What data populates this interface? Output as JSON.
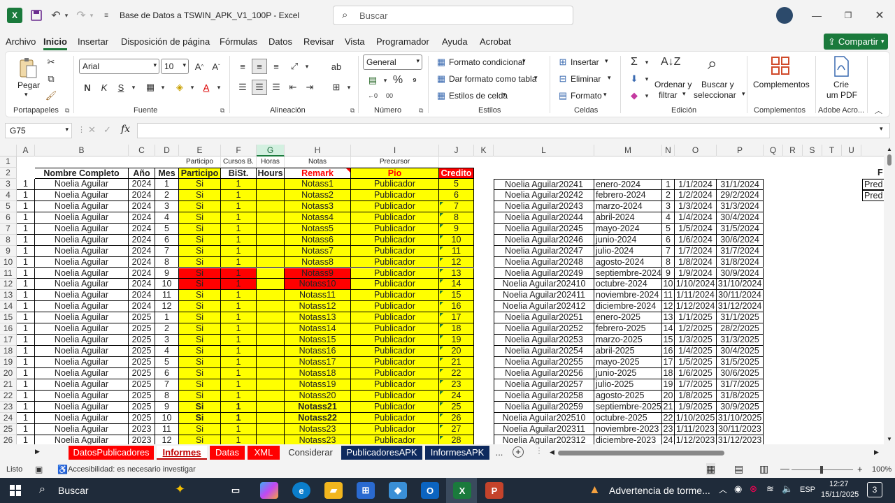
{
  "titlebar": {
    "title": "Base de Datos a TSWIN_APK_V1_100P  -  Excel",
    "search_placeholder": "Buscar"
  },
  "menu": [
    "Archivo",
    "Inicio",
    "Insertar",
    "Disposición de página",
    "Fórmulas",
    "Datos",
    "Revisar",
    "Vista",
    "Programador",
    "Ayuda",
    "Acrobat"
  ],
  "share_label": "Compartir",
  "ribbon": {
    "paste": "Pegar",
    "font_name": "Arial",
    "font_size": "10",
    "number_format": "General",
    "cond_format": "Formato condicional",
    "table_format": "Dar formato como tabla",
    "cell_styles": "Estilos de celda",
    "insert": "Insertar",
    "delete": "Eliminar",
    "format": "Formato",
    "sort_filter_1": "Ordenar y",
    "sort_filter_2": "filtrar",
    "find_select_1": "Buscar y",
    "find_select_2": "seleccionar",
    "addins": "Complementos",
    "pdf_1": "Crie",
    "pdf_2": "um PDF",
    "groups": [
      "Portapapeles",
      "Fuente",
      "Alineación",
      "Número",
      "Estilos",
      "Celdas",
      "Edición",
      "Complementos",
      "Adobe Acro..."
    ],
    "bold": "N",
    "italic": "K",
    "underline": "S"
  },
  "namebox": "G75",
  "fx": "fx",
  "columns": [
    "A",
    "B",
    "C",
    "D",
    "E",
    "F",
    "G",
    "H",
    "I",
    "J",
    "K",
    "L",
    "M",
    "N",
    "O",
    "P",
    "Q",
    "R",
    "S",
    "T",
    "U"
  ],
  "row1": {
    "E": "Participo",
    "F": "Cursos B.",
    "G": "Horas",
    "H": "Notas",
    "I": "Precursor"
  },
  "row2": {
    "B": "Nombre Completo",
    "C": "Año",
    "D": "Mes",
    "E": "Participo",
    "F": "BiSt.",
    "G": "Hours",
    "H": "Remark",
    "I": "Pio",
    "J": "Credito"
  },
  "rows": [
    {
      "a": "1",
      "b": "Noelia Aguilar",
      "c": "2024",
      "d": "1",
      "e": "Si",
      "f": "1",
      "h": "Notass1",
      "i": "Publicador",
      "j": "5",
      "l": "Noelia Aguilar20241",
      "m": "enero-2024",
      "n": "1",
      "o": "1/1/2024",
      "p": "31/1/2024"
    },
    {
      "a": "1",
      "b": "Noelia Aguilar",
      "c": "2024",
      "d": "2",
      "e": "Si",
      "f": "1",
      "h": "Notass2",
      "i": "Publicador",
      "j": "6",
      "l": "Noelia Aguilar20242",
      "m": "febrero-2024",
      "n": "2",
      "o": "1/2/2024",
      "p": "29/2/2024"
    },
    {
      "a": "1",
      "b": "Noelia Aguilar",
      "c": "2024",
      "d": "3",
      "e": "Si",
      "f": "1",
      "h": "Notass3",
      "i": "Publicador",
      "j": "7",
      "l": "Noelia Aguilar20243",
      "m": "marzo-2024",
      "n": "3",
      "o": "1/3/2024",
      "p": "31/3/2024"
    },
    {
      "a": "1",
      "b": "Noelia Aguilar",
      "c": "2024",
      "d": "4",
      "e": "Si",
      "f": "1",
      "h": "Notass4",
      "i": "Publicador",
      "j": "8",
      "l": "Noelia Aguilar20244",
      "m": "abril-2024",
      "n": "4",
      "o": "1/4/2024",
      "p": "30/4/2024"
    },
    {
      "a": "1",
      "b": "Noelia Aguilar",
      "c": "2024",
      "d": "5",
      "e": "Si",
      "f": "1",
      "h": "Notass5",
      "i": "Publicador",
      "j": "9",
      "l": "Noelia Aguilar20245",
      "m": "mayo-2024",
      "n": "5",
      "o": "1/5/2024",
      "p": "31/5/2024"
    },
    {
      "a": "1",
      "b": "Noelia Aguilar",
      "c": "2024",
      "d": "6",
      "e": "Si",
      "f": "1",
      "h": "Notass6",
      "i": "Publicador",
      "j": "10",
      "l": "Noelia Aguilar20246",
      "m": "junio-2024",
      "n": "6",
      "o": "1/6/2024",
      "p": "30/6/2024"
    },
    {
      "a": "1",
      "b": "Noelia Aguilar",
      "c": "2024",
      "d": "7",
      "e": "Si",
      "f": "1",
      "h": "Notass7",
      "i": "Publicador",
      "j": "11",
      "l": "Noelia Aguilar20247",
      "m": "julio-2024",
      "n": "7",
      "o": "1/7/2024",
      "p": "31/7/2024"
    },
    {
      "a": "1",
      "b": "Noelia Aguilar",
      "c": "2024",
      "d": "8",
      "e": "Si",
      "f": "1",
      "h": "Notass8",
      "i": "Publicador",
      "j": "12",
      "l": "Noelia Aguilar20248",
      "m": "agosto-2024",
      "n": "8",
      "o": "1/8/2024",
      "p": "31/8/2024"
    },
    {
      "a": "1",
      "b": "Noelia Aguilar",
      "c": "2024",
      "d": "9",
      "e": "Si",
      "f": "1",
      "h": "Notass9",
      "i": "Publicador",
      "j": "13",
      "l": "Noelia Aguilar20249",
      "m": "septiembre-2024",
      "n": "9",
      "o": "1/9/2024",
      "p": "30/9/2024",
      "red": true
    },
    {
      "a": "1",
      "b": "Noelia Aguilar",
      "c": "2024",
      "d": "10",
      "e": "Si",
      "f": "1",
      "h": "Notass10",
      "i": "Publicador",
      "j": "14",
      "l": "Noelia Aguilar202410",
      "m": "octubre-2024",
      "n": "10",
      "o": "1/10/2024",
      "p": "31/10/2024",
      "red": true
    },
    {
      "a": "1",
      "b": "Noelia Aguilar",
      "c": "2024",
      "d": "11",
      "e": "Si",
      "f": "1",
      "h": "Notass11",
      "i": "Publicador",
      "j": "15",
      "l": "Noelia Aguilar202411",
      "m": "noviembre-2024",
      "n": "11",
      "o": "1/11/2024",
      "p": "30/11/2024"
    },
    {
      "a": "1",
      "b": "Noelia Aguilar",
      "c": "2024",
      "d": "12",
      "e": "Si",
      "f": "1",
      "h": "Notass12",
      "i": "Publicador",
      "j": "16",
      "l": "Noelia Aguilar202412",
      "m": "diciembre-2024",
      "n": "12",
      "o": "1/12/2024",
      "p": "31/12/2024"
    },
    {
      "a": "1",
      "b": "Noelia Aguilar",
      "c": "2025",
      "d": "1",
      "e": "Si",
      "f": "1",
      "h": "Notass13",
      "i": "Publicador",
      "j": "17",
      "l": "Noelia Aguilar20251",
      "m": "enero-2025",
      "n": "13",
      "o": "1/1/2025",
      "p": "31/1/2025"
    },
    {
      "a": "1",
      "b": "Noelia Aguilar",
      "c": "2025",
      "d": "2",
      "e": "Si",
      "f": "1",
      "h": "Notass14",
      "i": "Publicador",
      "j": "18",
      "l": "Noelia Aguilar20252",
      "m": "febrero-2025",
      "n": "14",
      "o": "1/2/2025",
      "p": "28/2/2025"
    },
    {
      "a": "1",
      "b": "Noelia Aguilar",
      "c": "2025",
      "d": "3",
      "e": "Si",
      "f": "1",
      "h": "Notass15",
      "i": "Publicador",
      "j": "19",
      "l": "Noelia Aguilar20253",
      "m": "marzo-2025",
      "n": "15",
      "o": "1/3/2025",
      "p": "31/3/2025"
    },
    {
      "a": "1",
      "b": "Noelia Aguilar",
      "c": "2025",
      "d": "4",
      "e": "Si",
      "f": "1",
      "h": "Notass16",
      "i": "Publicador",
      "j": "20",
      "l": "Noelia Aguilar20254",
      "m": "abril-2025",
      "n": "16",
      "o": "1/4/2025",
      "p": "30/4/2025"
    },
    {
      "a": "1",
      "b": "Noelia Aguilar",
      "c": "2025",
      "d": "5",
      "e": "Si",
      "f": "1",
      "h": "Notass17",
      "i": "Publicador",
      "j": "21",
      "l": "Noelia Aguilar20255",
      "m": "mayo-2025",
      "n": "17",
      "o": "1/5/2025",
      "p": "31/5/2025"
    },
    {
      "a": "1",
      "b": "Noelia Aguilar",
      "c": "2025",
      "d": "6",
      "e": "Si",
      "f": "1",
      "h": "Notass18",
      "i": "Publicador",
      "j": "22",
      "l": "Noelia Aguilar20256",
      "m": "junio-2025",
      "n": "18",
      "o": "1/6/2025",
      "p": "30/6/2025"
    },
    {
      "a": "1",
      "b": "Noelia Aguilar",
      "c": "2025",
      "d": "7",
      "e": "Si",
      "f": "1",
      "h": "Notass19",
      "i": "Publicador",
      "j": "23",
      "l": "Noelia Aguilar20257",
      "m": "julio-2025",
      "n": "19",
      "o": "1/7/2025",
      "p": "31/7/2025"
    },
    {
      "a": "1",
      "b": "Noelia Aguilar",
      "c": "2025",
      "d": "8",
      "e": "Si",
      "f": "1",
      "h": "Notass20",
      "i": "Publicador",
      "j": "24",
      "l": "Noelia Aguilar20258",
      "m": "agosto-2025",
      "n": "20",
      "o": "1/8/2025",
      "p": "31/8/2025"
    },
    {
      "a": "1",
      "b": "Noelia Aguilar",
      "c": "2025",
      "d": "9",
      "e": "Si",
      "f": "1",
      "h": "Notass21",
      "i": "Publicador",
      "j": "25",
      "l": "Noelia Aguilar20259",
      "m": "septiembre-2025",
      "n": "21",
      "o": "1/9/2025",
      "p": "30/9/2025",
      "bold": true
    },
    {
      "a": "1",
      "b": "Noelia Aguilar",
      "c": "2025",
      "d": "10",
      "e": "Si",
      "f": "1",
      "h": "Notass22",
      "i": "Publicador",
      "j": "26",
      "l": "Noelia Aguilar202510",
      "m": "octubre-2025",
      "n": "22",
      "o": "1/10/2025",
      "p": "31/10/2025",
      "bold": true
    },
    {
      "a": "1",
      "b": "Noelia Aguilar",
      "c": "2023",
      "d": "11",
      "e": "Si",
      "f": "1",
      "h": "Notass23",
      "i": "Publicador",
      "j": "27",
      "l": "Noelia Aguilar202311",
      "m": "noviembre-2023",
      "n": "23",
      "o": "1/11/2023",
      "p": "30/11/2023"
    },
    {
      "a": "1",
      "b": "Noelia Aguilar",
      "c": "2023",
      "d": "12",
      "e": "Si",
      "f": "1",
      "h": "Notass23",
      "i": "Publicador",
      "j": "28",
      "l": "Noelia Aguilar202312",
      "m": "diciembre-2023",
      "n": "24",
      "o": "1/12/2023",
      "p": "31/12/2023"
    }
  ],
  "far_right": {
    "row2": "F",
    "row3": "Pred",
    "row4": "Pred"
  },
  "sheets": [
    "DatosPublicadores",
    "Informes",
    "Datas",
    "XML",
    "Considerar",
    "PublicadoresAPK",
    "InformesAPK"
  ],
  "sheets_more": "...",
  "status": {
    "ready": "Listo",
    "accessibility": "Accesibilidad: es necesario investigar",
    "zoom": "100%"
  },
  "taskbar": {
    "search": "Buscar",
    "weather": "Advertencia de torme...",
    "lang": "ESP",
    "time": "12:27",
    "date": "15/11/2025",
    "notif": "3"
  },
  "colors": {
    "excel_green": "#1a7a3c",
    "yellow": "#ffff00",
    "red": "#ff0000",
    "remark_red": "#ff0000"
  }
}
